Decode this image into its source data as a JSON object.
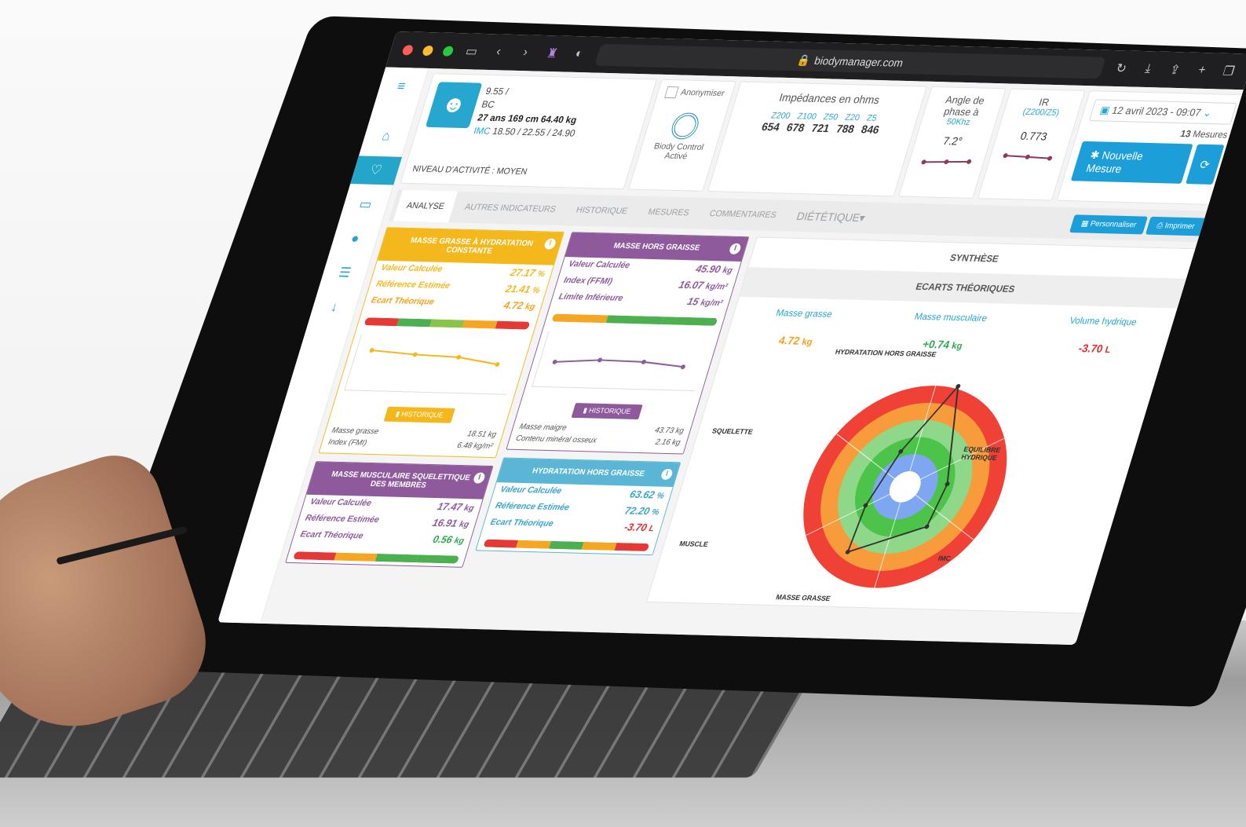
{
  "browser": {
    "url": "biodymanager.com",
    "lock_icon": "lock-icon"
  },
  "patient": {
    "line1": "9.55 /",
    "line2": "BC",
    "line3": "27 ans 169 cm 64.40 kg",
    "imc_label": "IMC",
    "imc_values": "18.50 / 22.55 / 24.90",
    "activity": "NIVEAU D'ACTIVITÉ : MOYEN"
  },
  "anon": {
    "label": "Anonymiser",
    "device_label_1": "Biody Control",
    "device_label_2": "Activé"
  },
  "impedances": {
    "title": "Impédances en ohms",
    "freqs": [
      "Z200",
      "Z100",
      "Z50",
      "Z20",
      "Z5"
    ],
    "values": [
      "654",
      "678",
      "721",
      "788",
      "846"
    ]
  },
  "angle": {
    "title_1": "Angle de",
    "title_2": "phase à",
    "freq": "50Khz",
    "value": "7.2°"
  },
  "ir": {
    "title": "IR",
    "sub": "(Z200/Z5)",
    "value": "0.773"
  },
  "date": {
    "value": "12 avril 2023 - 09:07",
    "count": "13",
    "count_label": "Mesures",
    "new_label": "Nouvelle Mesure"
  },
  "tabs": [
    "ANALYSE",
    "AUTRES INDICATEURS",
    "HISTORIQUE",
    "MESURES",
    "COMMENTAIRES",
    "DIÉTÉTIQUE"
  ],
  "tab_actions": {
    "customize": "Personnaliser",
    "print": "Imprimer"
  },
  "colors": {
    "yellow": "#f4b81c",
    "purple": "#8e5a9c",
    "blue": "#5ab6d4",
    "accent": "#1c9fd8"
  },
  "panels": {
    "mg": {
      "title": "MASSE GRASSE À HYDRATATION CONSTANTE",
      "rows": [
        {
          "label": "Valeur Calculée",
          "value": "27.17",
          "unit": "%"
        },
        {
          "label": "Référence Estimée",
          "value": "21.41",
          "unit": "%"
        },
        {
          "label": "Ecart Théorique",
          "value": "4.72",
          "unit": "kg"
        }
      ],
      "history": "HISTORIQUE",
      "foot": [
        {
          "label": "Masse grasse",
          "value": "18.51 kg"
        },
        {
          "label": "Index (FMI)",
          "value": "6.48 kg/m²"
        }
      ]
    },
    "mhg": {
      "title": "MASSE HORS GRAISSE",
      "rows": [
        {
          "label": "Valeur Calculée",
          "value": "45.90",
          "unit": "kg"
        },
        {
          "label": "Index (FFMI)",
          "value": "16.07",
          "unit": "kg/m²"
        },
        {
          "label": "Limite Inférieure",
          "value": "15",
          "unit": "kg/m²"
        }
      ],
      "history": "HISTORIQUE",
      "foot": [
        {
          "label": "Masse maigre",
          "value": "43.73 kg"
        },
        {
          "label": "Contenu minéral osseux",
          "value": "2.16 kg"
        }
      ]
    },
    "mmsm": {
      "title": "MASSE MUSCULAIRE SQUELETTIQUE DES MEMBRES",
      "rows": [
        {
          "label": "Valeur Calculée",
          "value": "17.47",
          "unit": "kg"
        },
        {
          "label": "Référence Estimée",
          "value": "16.91",
          "unit": "kg"
        },
        {
          "label": "Ecart Théorique",
          "value": "0.56",
          "unit": "kg"
        }
      ]
    },
    "hhg": {
      "title": "HYDRATATION HORS GRAISSE",
      "rows": [
        {
          "label": "Valeur Calculée",
          "value": "63.62",
          "unit": "%"
        },
        {
          "label": "Référence Estimée",
          "value": "72.20",
          "unit": "%"
        },
        {
          "label": "Ecart Théorique",
          "value": "-3.70",
          "unit": "L"
        }
      ]
    }
  },
  "synthesis": {
    "title": "SYNTHÈSE",
    "ecarts_title": "ECARTS THÉORIQUES",
    "ecarts": [
      {
        "label": "Masse grasse",
        "value": "4.72",
        "unit": "kg",
        "color": "#f4a21c"
      },
      {
        "label": "Masse musculaire",
        "value": "+0.74",
        "unit": "kg",
        "color": "#2fa84f"
      },
      {
        "label": "Volume hydrique",
        "value": "-3.70",
        "unit": "L",
        "color": "#e52a2a"
      }
    ],
    "radar_labels": {
      "top": "HYDRATATION HORS GRAISSE",
      "left": "SQUELETTE",
      "right": "EQUILIBRE HYDRIQUE",
      "bottom_left": "MUSCLE",
      "bottom_right": "IMC",
      "bottom": "MASSE GRASSE"
    }
  }
}
